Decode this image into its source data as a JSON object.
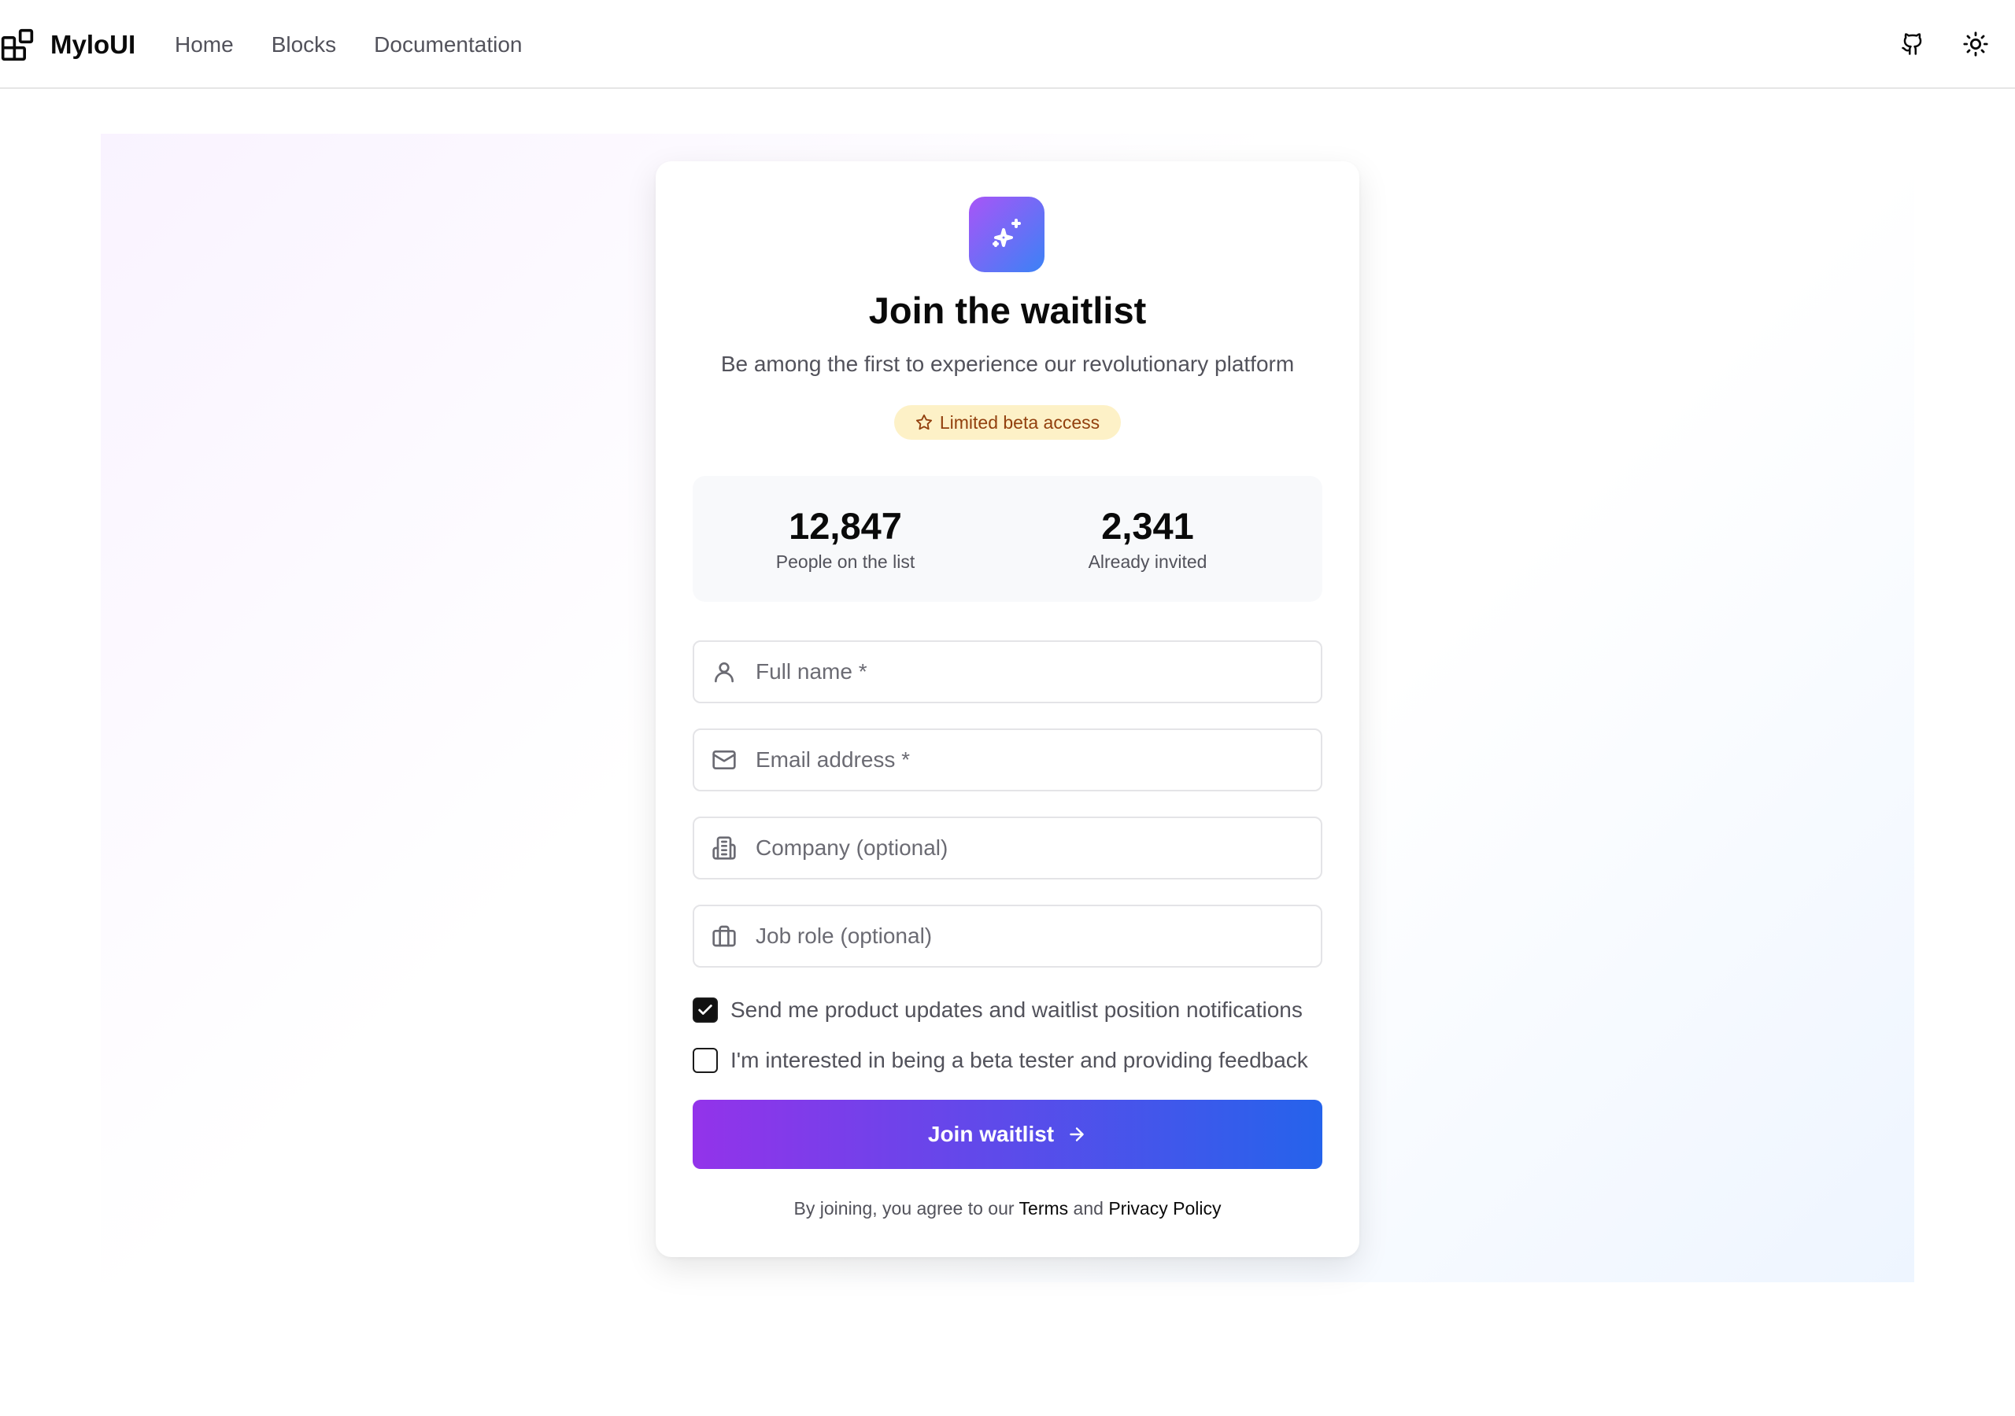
{
  "nav": {
    "brand": "MyloUI",
    "links": [
      "Home",
      "Blocks",
      "Documentation"
    ],
    "icons": [
      "github-icon",
      "sun-icon"
    ]
  },
  "card": {
    "icon": "sparkles-icon",
    "title": "Join the waitlist",
    "subtitle": "Be among the first to experience our revolutionary platform",
    "badge": "Limited beta access",
    "stats": [
      {
        "value": "12,847",
        "label": "People on the list"
      },
      {
        "value": "2,341",
        "label": "Already invited"
      }
    ],
    "fields": [
      {
        "placeholder": "Full name *",
        "icon": "user-icon",
        "value": ""
      },
      {
        "placeholder": "Email address *",
        "icon": "mail-icon",
        "value": ""
      },
      {
        "placeholder": "Company (optional)",
        "icon": "building-icon",
        "value": ""
      },
      {
        "placeholder": "Job role (optional)",
        "icon": "briefcase-icon",
        "value": ""
      }
    ],
    "checkboxes": [
      {
        "label": "Send me product updates and waitlist position notifications",
        "checked": true
      },
      {
        "label": "I'm interested in being a beta tester and providing feedback",
        "checked": false
      }
    ],
    "cta": "Join waitlist",
    "legal": {
      "prefix": "By joining, you agree to our",
      "terms": "Terms",
      "and": "and",
      "privacy": "Privacy Policy"
    }
  },
  "colors": {
    "accent_start": "#9333ea",
    "accent_end": "#2563eb",
    "badge_bg": "#fdf1c7",
    "badge_text": "#92400e"
  }
}
